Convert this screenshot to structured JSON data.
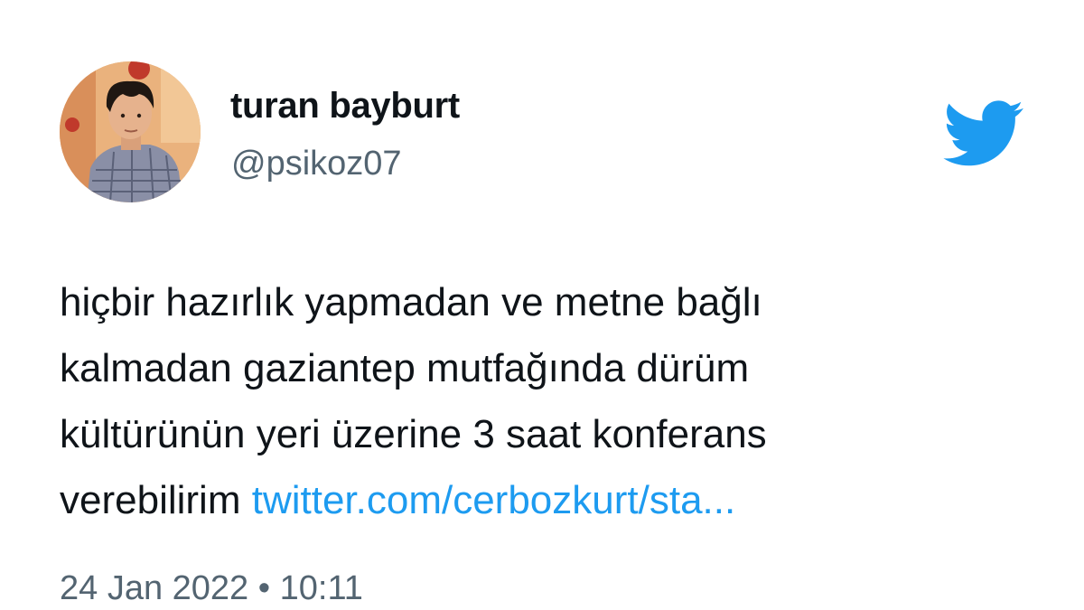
{
  "tweet": {
    "author": {
      "display_name": "turan bayburt",
      "handle": "@psikoz07"
    },
    "text_lines": [
      "hiçbir hazırlık yapmadan ve metne bağlı",
      "kalmadan gaziantep mutfağında dürüm",
      "kültürünün yeri üzerine 3 saat konferans",
      "verebilirim"
    ],
    "link_text": "twitter.com/cerbozkurt/sta...",
    "date": "24 Jan 2022",
    "separator": "•",
    "time": "10:11"
  },
  "icons": {
    "brand_logo": "twitter-bird-icon",
    "avatar": "profile-photo"
  },
  "colors": {
    "brand": "#1d9bf0",
    "text_primary": "#0f1419",
    "text_secondary": "#536471",
    "background": "#ffffff"
  }
}
